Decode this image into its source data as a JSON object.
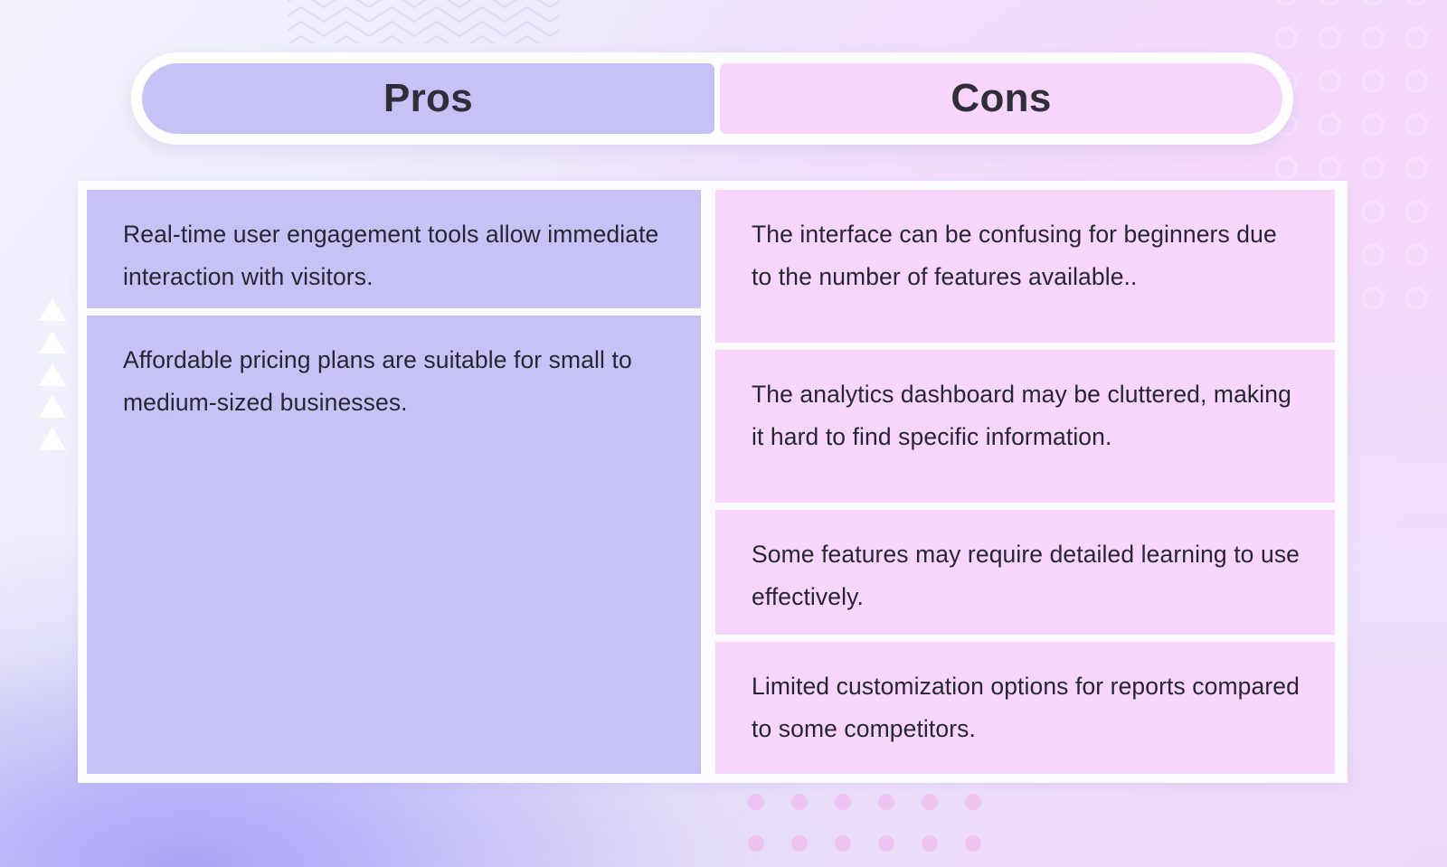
{
  "header": {
    "pros_label": "Pros",
    "cons_label": "Cons"
  },
  "table": {
    "pros": [
      "Real-time user engagement tools allow immediate interaction with visitors.",
      "Affordable pricing plans are suitable for small to medium-sized businesses."
    ],
    "cons": [
      "The interface can be confusing for beginners due to the number of features available..",
      "The analytics dashboard may be cluttered, making it hard to find specific information.",
      "Some features may require detailed learning to use effectively.",
      "Limited customization options for reports compared to some competitors."
    ]
  },
  "decorations": {
    "chevron_pattern": "zigzag-chevron-lines",
    "circle_pattern": "circle-outline-grid",
    "dot_pattern": "pink-dot-grid",
    "triangle_marks": "white-up-triangles",
    "triangle_count": 5
  },
  "colors": {
    "pros_fill": "#c6c2f6",
    "cons_fill": "#f7d5fc",
    "text": "#262733",
    "frame": "#fbfaff",
    "triangle": "#ffffff",
    "chevron_line": "#d9d6f2",
    "circle_line": "#f6e2fb",
    "dot": "#f4b6ec"
  }
}
